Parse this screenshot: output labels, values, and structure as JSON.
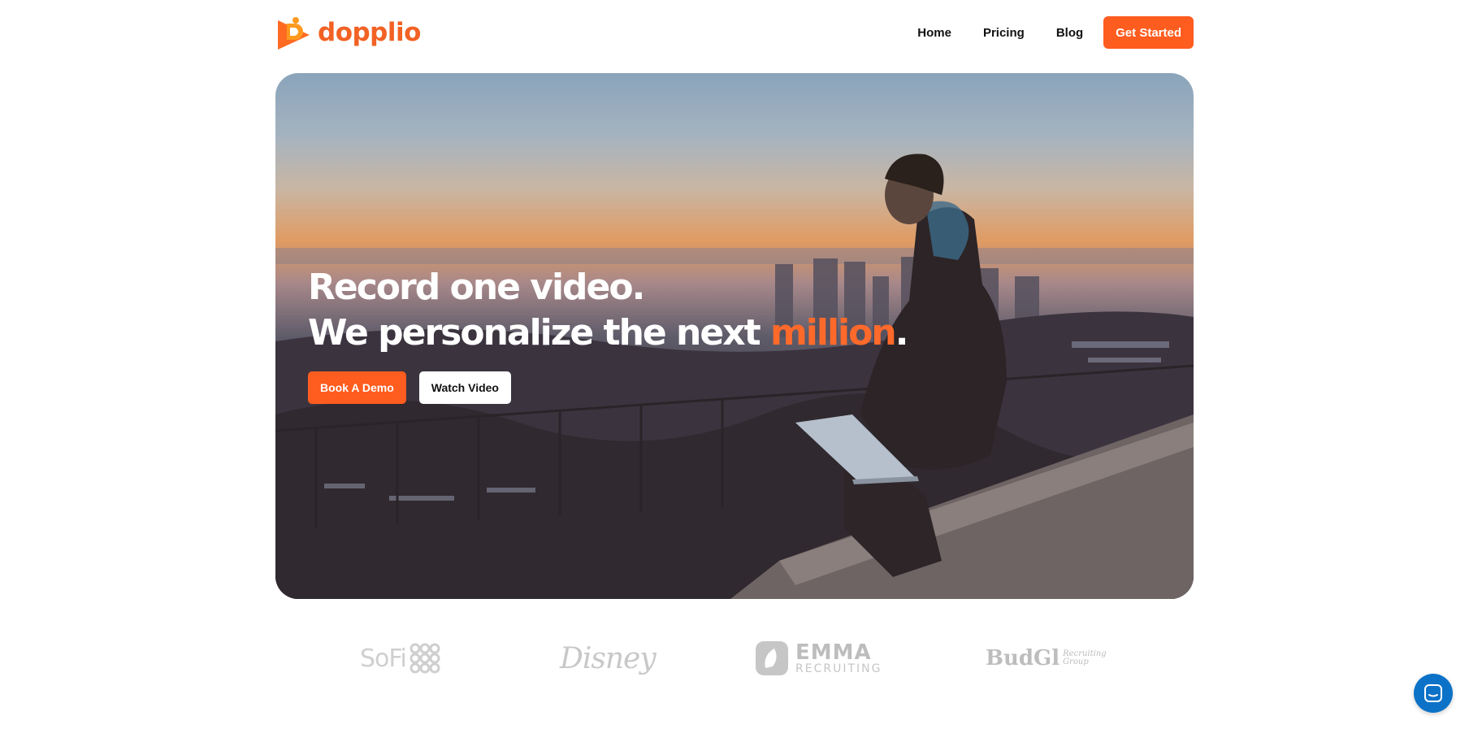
{
  "header": {
    "logo_text": "dopplio",
    "nav": [
      "Home",
      "Pricing",
      "Blog"
    ],
    "cta_label": "Get Started"
  },
  "hero": {
    "headline_line1": "Record one video.",
    "headline_line2_prefix": "We personalize the next ",
    "headline_accent": "million",
    "headline_suffix": ".",
    "primary_button": "Book A Demo",
    "secondary_button": "Watch Video"
  },
  "customer_logos": {
    "sofi": "SoFi",
    "disney": "Disney",
    "emma": "EMMA",
    "emma_sub": "RECRUITING",
    "budgi": "BudGl",
    "budgi_sub": "Recruiting Group"
  },
  "colors": {
    "brand": "#ff5c1f",
    "accent_text": "#ff6a2b",
    "chat_bubble": "#0b72c7"
  },
  "icons": {
    "logo": "dopplio-play-icon",
    "chat": "chat-icon"
  }
}
